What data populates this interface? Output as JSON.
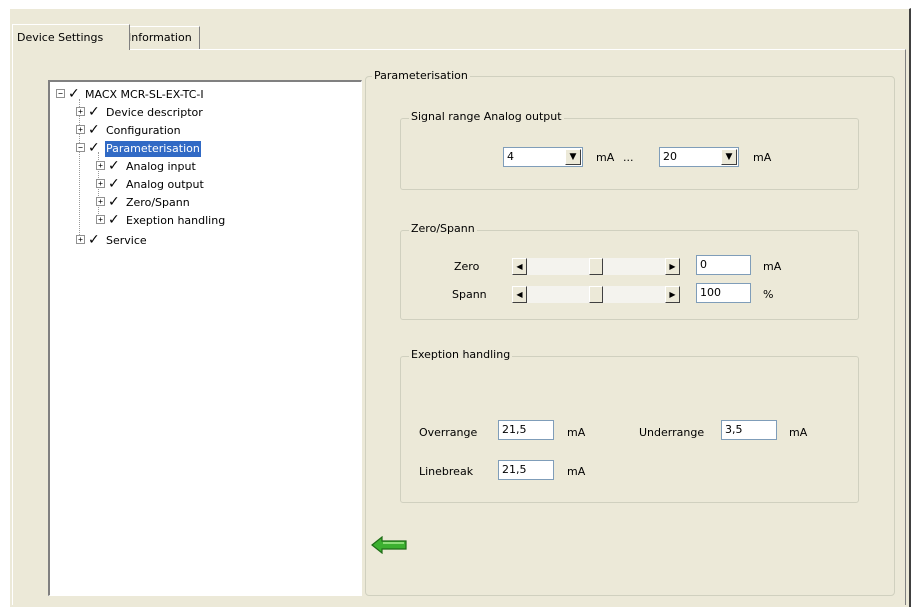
{
  "tabs": [
    {
      "label": "Device Settings",
      "active": true
    },
    {
      "label": "Information",
      "active": false
    }
  ],
  "tree": {
    "root": "MACX MCR-SL-EX-TC-I",
    "items": [
      "Device descriptor",
      "Configuration",
      "Parameterisation",
      "Analog input",
      "Analog output",
      "Zero/Spann",
      "Exeption handling",
      "Service"
    ],
    "selected": "Parameterisation"
  },
  "parameterisation": {
    "title": "Parameterisation",
    "signal_range": {
      "title": "Signal range Analog output",
      "from_value": "4",
      "from_unit": "mA",
      "separator": "...",
      "to_value": "20",
      "to_unit": "mA"
    },
    "zero_spann": {
      "title": "Zero/Spann",
      "zero_label": "Zero",
      "zero_value": "0",
      "zero_unit": "mA",
      "zero_slider_level": 0.5,
      "spann_label": "Spann",
      "spann_value": "100",
      "spann_unit": "%",
      "spann_slider_level": 0.5
    },
    "exception": {
      "title": "Exeption handling",
      "overrange_label": "Overrange",
      "overrange_value": "21,5",
      "overrange_unit": "mA",
      "underrange_label": "Underrange",
      "underrange_value": "3,5",
      "underrange_unit": "mA",
      "linebreak_label": "Linebreak",
      "linebreak_value": "21,5",
      "linebreak_unit": "mA"
    }
  },
  "icons": {
    "back_arrow": "back-arrow-icon",
    "expand": "plus-box-icon",
    "collapse": "minus-box-icon",
    "check": "checkmark-icon"
  },
  "colors": {
    "selection": "#316ac5",
    "dialog_bg": "#ece9d8",
    "arrow_green": "#3cb030"
  }
}
